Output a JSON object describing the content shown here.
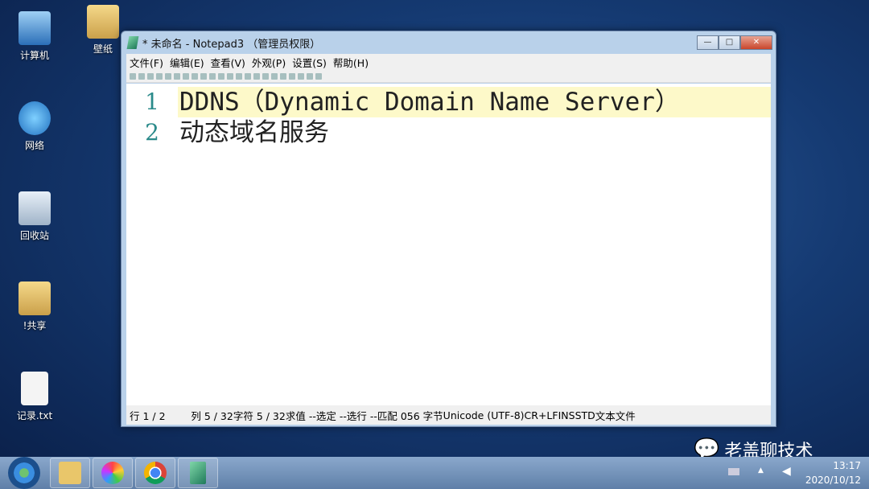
{
  "desktop": {
    "icons": [
      "计算机",
      "壁纸",
      "网络",
      "回收站",
      "!共享",
      "记录.txt"
    ]
  },
  "window": {
    "title": "* 未命名 - Notepad3 （管理员权限）",
    "controls": {
      "minimize": "—",
      "maximize": "□",
      "close": "✕"
    },
    "menu": [
      "文件(F)",
      "编辑(E)",
      "查看(V)",
      "外观(P)",
      "设置(S)",
      "帮助(H)"
    ],
    "lines": [
      {
        "num": "1",
        "text": "DDNS（Dynamic Domain Name Server）"
      },
      {
        "num": "2",
        "text": "动态域名服务"
      }
    ],
    "status": {
      "line": "行 1 / 2",
      "column": "列 5 / 32",
      "chars": "字符 5 / 32",
      "eval": "求值 --",
      "selected": "选定 --",
      "sel_lines": "选行 --",
      "match": "匹配 0",
      "bytes": "56 字节",
      "encoding": "Unicode (UTF-8)",
      "eol": "CR+LF",
      "ins": "INS",
      "std": "STD",
      "type": "文本文件"
    }
  },
  "watermark": "老盖聊技术",
  "tray": {
    "time": "13:17",
    "date": "2020/10/12"
  }
}
